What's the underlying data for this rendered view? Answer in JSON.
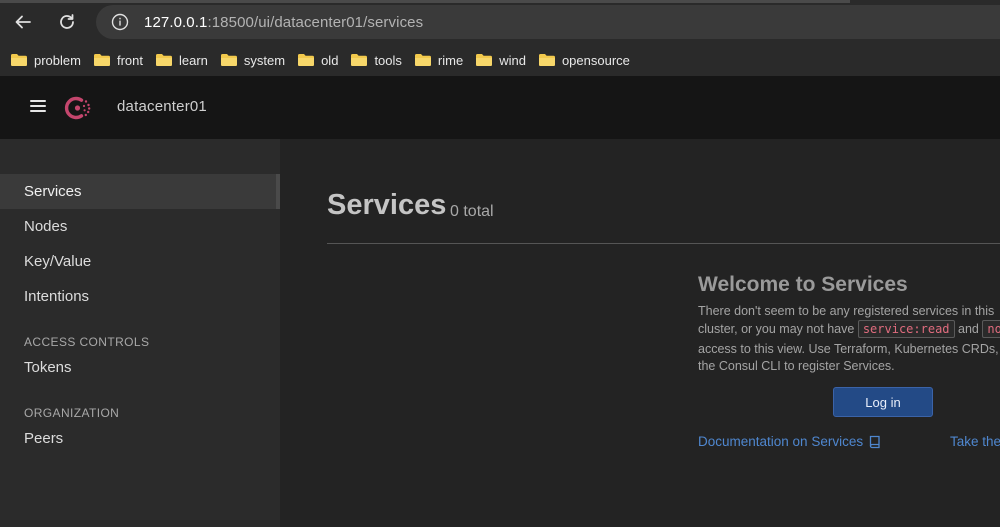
{
  "browser": {
    "url_host": "127.0.0.1",
    "url_rest": ":18500/ui/datacenter01/services",
    "bookmarks": [
      "problem",
      "front",
      "learn",
      "system",
      "old",
      "tools",
      "rime",
      "wind",
      "opensource"
    ]
  },
  "header": {
    "datacenter": "datacenter01"
  },
  "sidebar": {
    "items": [
      {
        "label": "Services"
      },
      {
        "label": "Nodes"
      },
      {
        "label": "Key/Value"
      },
      {
        "label": "Intentions"
      }
    ],
    "access_controls": {
      "heading": "ACCESS CONTROLS",
      "items": [
        {
          "label": "Tokens"
        }
      ]
    },
    "organization": {
      "heading": "ORGANIZATION",
      "items": [
        {
          "label": "Peers"
        }
      ]
    }
  },
  "main": {
    "title": "Services",
    "count": "0 total",
    "empty_state": {
      "title": "Welcome to Services",
      "line1": "There don't seem to be any registered services in this",
      "line2_a": "cluster, or you may not have",
      "code1": "service:read",
      "line2_b": "and",
      "code2": "no",
      "line3": "access to this view. Use Terraform, Kubernetes CRDs,",
      "line4": "the Consul CLI to register Services.",
      "login_label": "Log in",
      "doc_link": "Documentation on Services",
      "tour_link": "Take the"
    }
  },
  "colors": {
    "accent_link": "#4f87cf",
    "login_button": "#234a86",
    "code_text": "#e06c7e",
    "consul_logo": "#c4466d",
    "folder": "#f2c94c"
  },
  "icons": {
    "back": "back-arrow-icon",
    "reload": "reload-icon",
    "site_info": "info-icon",
    "folder": "folder-icon",
    "menu": "hamburger-icon",
    "logo": "consul-logo",
    "docs": "book-icon"
  }
}
